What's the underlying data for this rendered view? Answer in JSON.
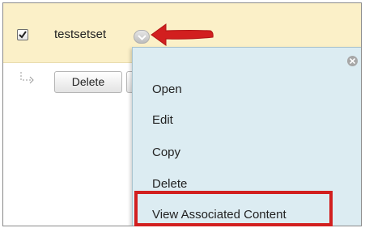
{
  "item": {
    "title": "testsetset",
    "checked": true
  },
  "actions": {
    "delete_label": "Delete"
  },
  "context_menu": {
    "items": [
      {
        "label": "Open"
      },
      {
        "label": "Edit"
      },
      {
        "label": "Copy"
      },
      {
        "label": "Delete"
      },
      {
        "label": "View Associated Content"
      }
    ],
    "close_icon": "close-circle-icon"
  },
  "annotations": {
    "arrow_color": "#d21f1f",
    "highlight_color": "#d21f1f"
  },
  "colors": {
    "selected_row_bg": "#fbf0c8",
    "menu_bg": "#dcecf2"
  }
}
